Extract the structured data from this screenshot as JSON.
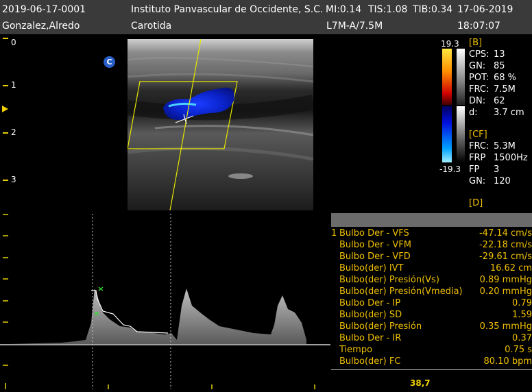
{
  "header": {
    "patient_id": "2019-06-17-0001",
    "patient_name": "Gonzalez,Alredo",
    "institution": "Instituto Panvascular de Occidente, S.C.",
    "mi": "MI:0.14",
    "tis": "TIS:1.08",
    "tib": "TIB:0.34",
    "date": "17-06-2019",
    "exam": "Carotida",
    "probe": "L7M-A/7.5M",
    "time": "18:07:07"
  },
  "depth_scale": {
    "labels": [
      "0",
      "1",
      "2",
      "3"
    ]
  },
  "color_marker": "C",
  "colorbar": {
    "max": "19.3",
    "min": "-19.3"
  },
  "params_b": {
    "title": "[B]",
    "rows": [
      {
        "k": "CPS:",
        "v": "13"
      },
      {
        "k": "GN:",
        "v": "85"
      },
      {
        "k": "POT:",
        "v": "68 %"
      },
      {
        "k": "FRC:",
        "v": "7.5M"
      },
      {
        "k": "DN:",
        "v": "62"
      },
      {
        "k": "d:",
        "v": "3.7 cm"
      }
    ]
  },
  "params_cf": {
    "title": "[CF]",
    "rows": [
      {
        "k": "FRC:",
        "v": "5.3M"
      },
      {
        "k": "FRP",
        "v": "1500Hz"
      },
      {
        "k": "FP",
        "v": "3"
      },
      {
        "k": "GN:",
        "v": "120"
      }
    ]
  },
  "params_d": {
    "title": "[D]"
  },
  "measurements": {
    "index_label": "1",
    "rows": [
      {
        "label": "Bulbo Der - VFS",
        "value": "-47.14 cm/s"
      },
      {
        "label": "Bulbo Der - VFM",
        "value": "-22.18 cm/s"
      },
      {
        "label": "Bulbo Der - VFD",
        "value": "-29.61 cm/s"
      },
      {
        "label": "Bulbo(der) IVT",
        "value": "16.62 cm"
      },
      {
        "label": "Bulbo(der) Presión(Vs)",
        "value": "0.89 mmHg"
      },
      {
        "label": "Bulbo(der) Presión(Vmedia)",
        "value": "0.20 mmHg"
      },
      {
        "label": "Bulbo Der - IP",
        "value": "0.79"
      },
      {
        "label": "Bulbo(der) SD",
        "value": "1.59"
      },
      {
        "label": "Bulbo(der) Presión",
        "value": "0.35 mmHg"
      },
      {
        "label": "Bulbo Der - IR",
        "value": "0.37"
      },
      {
        "label": "Tiempo",
        "value": "0.75 s"
      },
      {
        "label": "Bulbo(der) FC",
        "value": "80.10 bpm"
      }
    ]
  },
  "footer": {
    "angle": "38,7"
  }
}
